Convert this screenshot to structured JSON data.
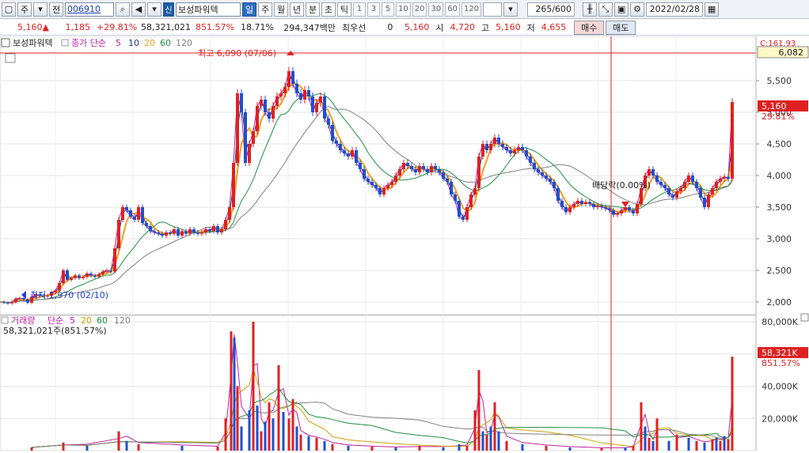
{
  "toolbar": {
    "period_selector": "주",
    "jeon": "전",
    "stock_code": "006910",
    "shin": "신",
    "stock_name": "보성파워텍",
    "periods": [
      "일",
      "주",
      "월",
      "년",
      "분",
      "초",
      "틱"
    ],
    "active_period": "일",
    "intervals": [
      "1",
      "3",
      "5",
      "10",
      "20",
      "30",
      "60",
      "120"
    ],
    "bar_count": "265",
    "bar_total": "/600",
    "date": "2022/02/28"
  },
  "quote": {
    "price": "5,160",
    "price_arrow": "▲",
    "change": "1,185",
    "change_pct": "+29.81%",
    "volume": "58,321,021",
    "volume_pct": "851.57%",
    "turnover": "18.71%",
    "amount": "294,347백만",
    "preferred_label": "최우선",
    "preferred_value": "0",
    "current": "5,160",
    "open_label": "시",
    "open": "4,720",
    "high_label": "고",
    "high": "5,160",
    "low_label": "저",
    "low": "4,655",
    "buy_label": "매수",
    "sell_label": "매도"
  },
  "price_panel": {
    "stock_label": "보성파워텍",
    "ma_label": "종가 단순",
    "ma_periods": [
      "5",
      "10",
      "20",
      "60",
      "120"
    ],
    "ma_colors": [
      "#c020a0",
      "#1f3a8a",
      "#f0a020",
      "#209040",
      "#808080"
    ],
    "high_note": "최고 6,090 (07/06)",
    "low_note": "최저 1,970 (02/10)",
    "dividend_note": "배당락(0.00%)",
    "top_right_label": "C:161.93",
    "crosshair_value": "6,082",
    "last_price_tag": "5,160",
    "last_pct_tag": "29.81%"
  },
  "volume_panel": {
    "label": "거래량",
    "ma_label": "단순",
    "ma_periods": [
      "5",
      "20",
      "60",
      "120"
    ],
    "ma_colors": [
      "#c020a0",
      "#d0a000",
      "#209040",
      "#808080"
    ],
    "value_note": "58,321,021주(851.57%)",
    "last_volume_tag": "58,321K",
    "last_pct_tag": "851.57%"
  },
  "chart_data": [
    {
      "type": "candlestick",
      "title": "보성파워텍",
      "y_ticks": [
        2000,
        2500,
        3000,
        3500,
        4000,
        4500,
        5000,
        5500
      ],
      "y_tick_labels": [
        "2,000",
        "2,500",
        "3,000",
        "3,500",
        "4,000",
        "4,500",
        "5,000",
        "5,500"
      ],
      "ylim": [
        1800,
        6200
      ],
      "points": [
        [
          0,
          2000
        ],
        [
          5,
          1990
        ],
        [
          10,
          1980
        ],
        [
          15,
          2000
        ],
        [
          20,
          2050
        ],
        [
          25,
          2060
        ],
        [
          30,
          2040
        ],
        [
          35,
          1990
        ],
        [
          40,
          2080
        ],
        [
          45,
          2120
        ],
        [
          50,
          2100
        ],
        [
          55,
          2090
        ],
        [
          60,
          2100
        ],
        [
          65,
          2150
        ],
        [
          70,
          2180
        ],
        [
          75,
          2300
        ],
        [
          80,
          2500
        ],
        [
          85,
          2350
        ],
        [
          90,
          2380
        ],
        [
          95,
          2420
        ],
        [
          100,
          2380
        ],
        [
          105,
          2400
        ],
        [
          110,
          2450
        ],
        [
          115,
          2420
        ],
        [
          120,
          2400
        ],
        [
          125,
          2440
        ],
        [
          130,
          2480
        ],
        [
          135,
          2500
        ],
        [
          140,
          2480
        ],
        [
          145,
          2850
        ],
        [
          150,
          3300
        ],
        [
          155,
          3500
        ],
        [
          160,
          3450
        ],
        [
          165,
          3350
        ],
        [
          170,
          3300
        ],
        [
          175,
          3500
        ],
        [
          180,
          3250
        ],
        [
          185,
          3200
        ],
        [
          190,
          3120
        ],
        [
          195,
          3100
        ],
        [
          200,
          3080
        ],
        [
          205,
          3050
        ],
        [
          210,
          3100
        ],
        [
          215,
          3080
        ],
        [
          220,
          3150
        ],
        [
          225,
          3050
        ],
        [
          230,
          3120
        ],
        [
          235,
          3080
        ],
        [
          240,
          3150
        ],
        [
          245,
          3100
        ],
        [
          250,
          3080
        ],
        [
          255,
          3100
        ],
        [
          260,
          3150
        ],
        [
          265,
          3120
        ],
        [
          270,
          3200
        ],
        [
          275,
          3100
        ],
        [
          280,
          3150
        ],
        [
          285,
          3300
        ],
        [
          290,
          3500
        ],
        [
          295,
          4200
        ],
        [
          300,
          5300
        ],
        [
          305,
          5000
        ],
        [
          310,
          4200
        ],
        [
          315,
          4500
        ],
        [
          320,
          4700
        ],
        [
          325,
          5100
        ],
        [
          330,
          5200
        ],
        [
          335,
          5000
        ],
        [
          340,
          4900
        ],
        [
          345,
          5100
        ],
        [
          350,
          5250
        ],
        [
          355,
          5300
        ],
        [
          360,
          5400
        ],
        [
          365,
          5650
        ],
        [
          370,
          5450
        ],
        [
          375,
          5300
        ],
        [
          380,
          5200
        ],
        [
          385,
          5350
        ],
        [
          390,
          5250
        ],
        [
          395,
          5000
        ],
        [
          400,
          5150
        ],
        [
          405,
          5250
        ],
        [
          410,
          4900
        ],
        [
          415,
          4800
        ],
        [
          420,
          4550
        ],
        [
          425,
          4500
        ],
        [
          430,
          4400
        ],
        [
          435,
          4350
        ],
        [
          440,
          4300
        ],
        [
          445,
          4400
        ],
        [
          450,
          4200
        ],
        [
          455,
          4100
        ],
        [
          460,
          3950
        ],
        [
          465,
          3900
        ],
        [
          470,
          3850
        ],
        [
          475,
          3800
        ],
        [
          480,
          3700
        ],
        [
          485,
          3800
        ],
        [
          490,
          3850
        ],
        [
          495,
          3900
        ],
        [
          500,
          4000
        ],
        [
          505,
          4100
        ],
        [
          510,
          4200
        ],
        [
          515,
          4150
        ],
        [
          520,
          4100
        ],
        [
          525,
          4050
        ],
        [
          530,
          4150
        ],
        [
          535,
          4100
        ],
        [
          540,
          4050
        ],
        [
          545,
          4150
        ],
        [
          550,
          4100
        ],
        [
          555,
          4050
        ],
        [
          560,
          3950
        ],
        [
          565,
          3900
        ],
        [
          570,
          3700
        ],
        [
          575,
          3600
        ],
        [
          580,
          3350
        ],
        [
          585,
          3300
        ],
        [
          590,
          3500
        ],
        [
          595,
          3700
        ],
        [
          600,
          3800
        ],
        [
          605,
          4300
        ],
        [
          610,
          4500
        ],
        [
          615,
          4400
        ],
        [
          620,
          4500
        ],
        [
          625,
          4600
        ],
        [
          630,
          4500
        ],
        [
          635,
          4450
        ],
        [
          640,
          4400
        ],
        [
          645,
          4350
        ],
        [
          650,
          4400
        ],
        [
          655,
          4450
        ],
        [
          660,
          4400
        ],
        [
          665,
          4300
        ],
        [
          670,
          4200
        ],
        [
          675,
          4100
        ],
        [
          680,
          4050
        ],
        [
          685,
          4000
        ],
        [
          690,
          3950
        ],
        [
          695,
          3900
        ],
        [
          700,
          3800
        ],
        [
          705,
          3600
        ],
        [
          710,
          3500
        ],
        [
          715,
          3420
        ],
        [
          720,
          3500
        ],
        [
          725,
          3550
        ],
        [
          730,
          3600
        ],
        [
          735,
          3550
        ],
        [
          740,
          3580
        ],
        [
          745,
          3550
        ],
        [
          750,
          3500
        ],
        [
          755,
          3520
        ],
        [
          760,
          3500
        ],
        [
          765,
          3480
        ],
        [
          770,
          3450
        ],
        [
          775,
          3380
        ],
        [
          780,
          3400
        ],
        [
          785,
          3450
        ],
        [
          790,
          3500
        ],
        [
          795,
          3450
        ],
        [
          800,
          3400
        ],
        [
          805,
          3550
        ],
        [
          810,
          3800
        ],
        [
          815,
          4000
        ],
        [
          820,
          4100
        ],
        [
          825,
          4000
        ],
        [
          830,
          3900
        ],
        [
          835,
          3850
        ],
        [
          840,
          3800
        ],
        [
          845,
          3700
        ],
        [
          850,
          3650
        ],
        [
          855,
          3750
        ],
        [
          860,
          3800
        ],
        [
          865,
          3900
        ],
        [
          870,
          4000
        ],
        [
          875,
          3900
        ],
        [
          880,
          3800
        ],
        [
          885,
          3650
        ],
        [
          890,
          3500
        ],
        [
          895,
          3700
        ],
        [
          900,
          3800
        ],
        [
          905,
          3900
        ],
        [
          910,
          3950
        ],
        [
          915,
          3980
        ],
        [
          920,
          3950
        ],
        [
          925,
          5160
        ]
      ]
    },
    {
      "type": "bar",
      "title": "거래량",
      "y_ticks": [
        20000,
        40000,
        60000,
        80000
      ],
      "y_tick_labels": [
        "20,000K",
        "40,000K",
        "60,000K",
        "80,000K"
      ],
      "ylim": [
        0,
        80000
      ],
      "bars": [
        [
          40,
          2000,
          "red"
        ],
        [
          80,
          5000,
          "red"
        ],
        [
          110,
          3000,
          "blue"
        ],
        [
          150,
          12000,
          "red"
        ],
        [
          160,
          6000,
          "blue"
        ],
        [
          175,
          4000,
          "red"
        ],
        [
          230,
          3000,
          "blue"
        ],
        [
          275,
          2500,
          "red"
        ],
        [
          285,
          20000,
          "red"
        ],
        [
          292,
          74000,
          "red"
        ],
        [
          296,
          70000,
          "blue"
        ],
        [
          300,
          40000,
          "red"
        ],
        [
          305,
          15000,
          "blue"
        ],
        [
          315,
          25000,
          "blue"
        ],
        [
          320,
          80000,
          "red"
        ],
        [
          325,
          28000,
          "blue"
        ],
        [
          330,
          12000,
          "red"
        ],
        [
          335,
          18000,
          "blue"
        ],
        [
          340,
          30000,
          "red"
        ],
        [
          345,
          20000,
          "blue"
        ],
        [
          352,
          53000,
          "red"
        ],
        [
          358,
          24000,
          "blue"
        ],
        [
          365,
          20000,
          "red"
        ],
        [
          370,
          32000,
          "red"
        ],
        [
          375,
          15000,
          "blue"
        ],
        [
          380,
          10000,
          "red"
        ],
        [
          390,
          9000,
          "blue"
        ],
        [
          400,
          8000,
          "red"
        ],
        [
          410,
          6000,
          "blue"
        ],
        [
          420,
          4000,
          "red"
        ],
        [
          440,
          3000,
          "blue"
        ],
        [
          470,
          2500,
          "red"
        ],
        [
          500,
          2000,
          "blue"
        ],
        [
          530,
          3000,
          "red"
        ],
        [
          560,
          2000,
          "blue"
        ],
        [
          580,
          4000,
          "blue"
        ],
        [
          590,
          3000,
          "red"
        ],
        [
          600,
          25000,
          "red"
        ],
        [
          605,
          50000,
          "red"
        ],
        [
          610,
          12000,
          "blue"
        ],
        [
          615,
          10000,
          "red"
        ],
        [
          620,
          15000,
          "blue"
        ],
        [
          625,
          30000,
          "red"
        ],
        [
          630,
          12000,
          "blue"
        ],
        [
          640,
          6000,
          "red"
        ],
        [
          660,
          4000,
          "blue"
        ],
        [
          690,
          3000,
          "red"
        ],
        [
          720,
          2000,
          "blue"
        ],
        [
          760,
          1500,
          "red"
        ],
        [
          790,
          2000,
          "blue"
        ],
        [
          800,
          3000,
          "red"
        ],
        [
          810,
          30000,
          "red"
        ],
        [
          815,
          15000,
          "blue"
        ],
        [
          820,
          8000,
          "red"
        ],
        [
          825,
          6000,
          "blue"
        ],
        [
          830,
          20000,
          "red"
        ],
        [
          845,
          6000,
          "blue"
        ],
        [
          855,
          10000,
          "red"
        ],
        [
          870,
          8000,
          "blue"
        ],
        [
          880,
          6000,
          "red"
        ],
        [
          890,
          5000,
          "blue"
        ],
        [
          900,
          7000,
          "red"
        ],
        [
          905,
          8000,
          "blue"
        ],
        [
          910,
          6000,
          "red"
        ],
        [
          915,
          9000,
          "blue"
        ],
        [
          920,
          7000,
          "red"
        ],
        [
          925,
          58321,
          "red"
        ]
      ]
    }
  ]
}
